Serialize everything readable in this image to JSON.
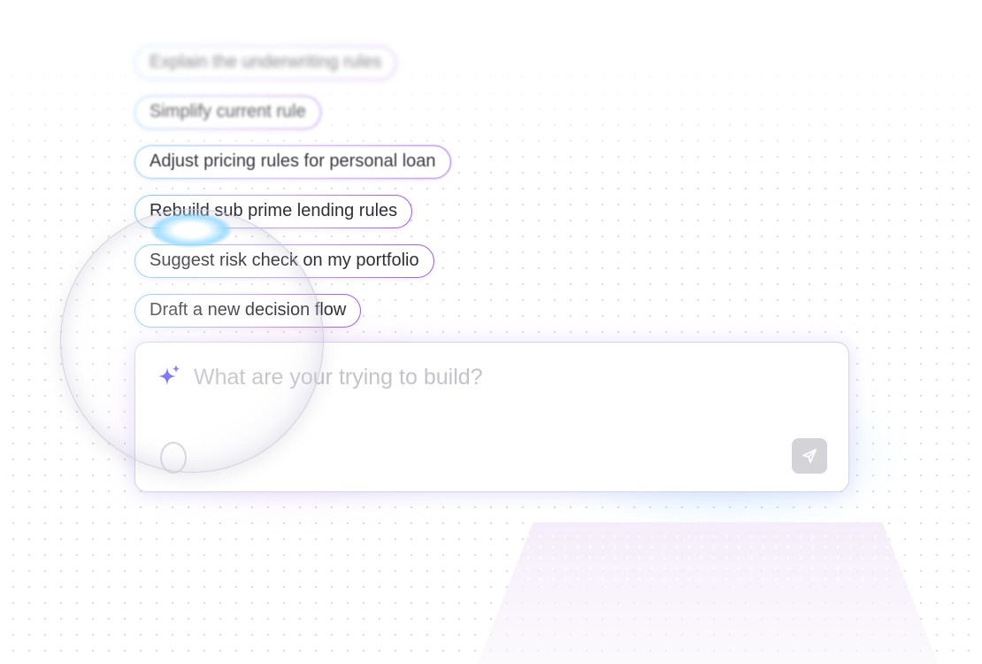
{
  "suggestions": [
    {
      "label": "Explain the underwriting rules"
    },
    {
      "label": "Simplify current rule"
    },
    {
      "label": "Adjust pricing rules for personal loan"
    },
    {
      "label": "Rebuild sub prime lending rules"
    },
    {
      "label": "Suggest risk check on my portfolio"
    },
    {
      "label": "Draft a new decision flow"
    }
  ],
  "prompt": {
    "value": "",
    "placeholder": "What are your trying to build?"
  },
  "icons": {
    "prompt_icon": "sparkle-icon",
    "send_icon": "send-icon"
  },
  "colors": {
    "accent_blue": "#7fd3f5",
    "accent_purple": "#9a5ce0",
    "sparkle": "#6b5cf0",
    "send_button": "#d3d3d8"
  }
}
